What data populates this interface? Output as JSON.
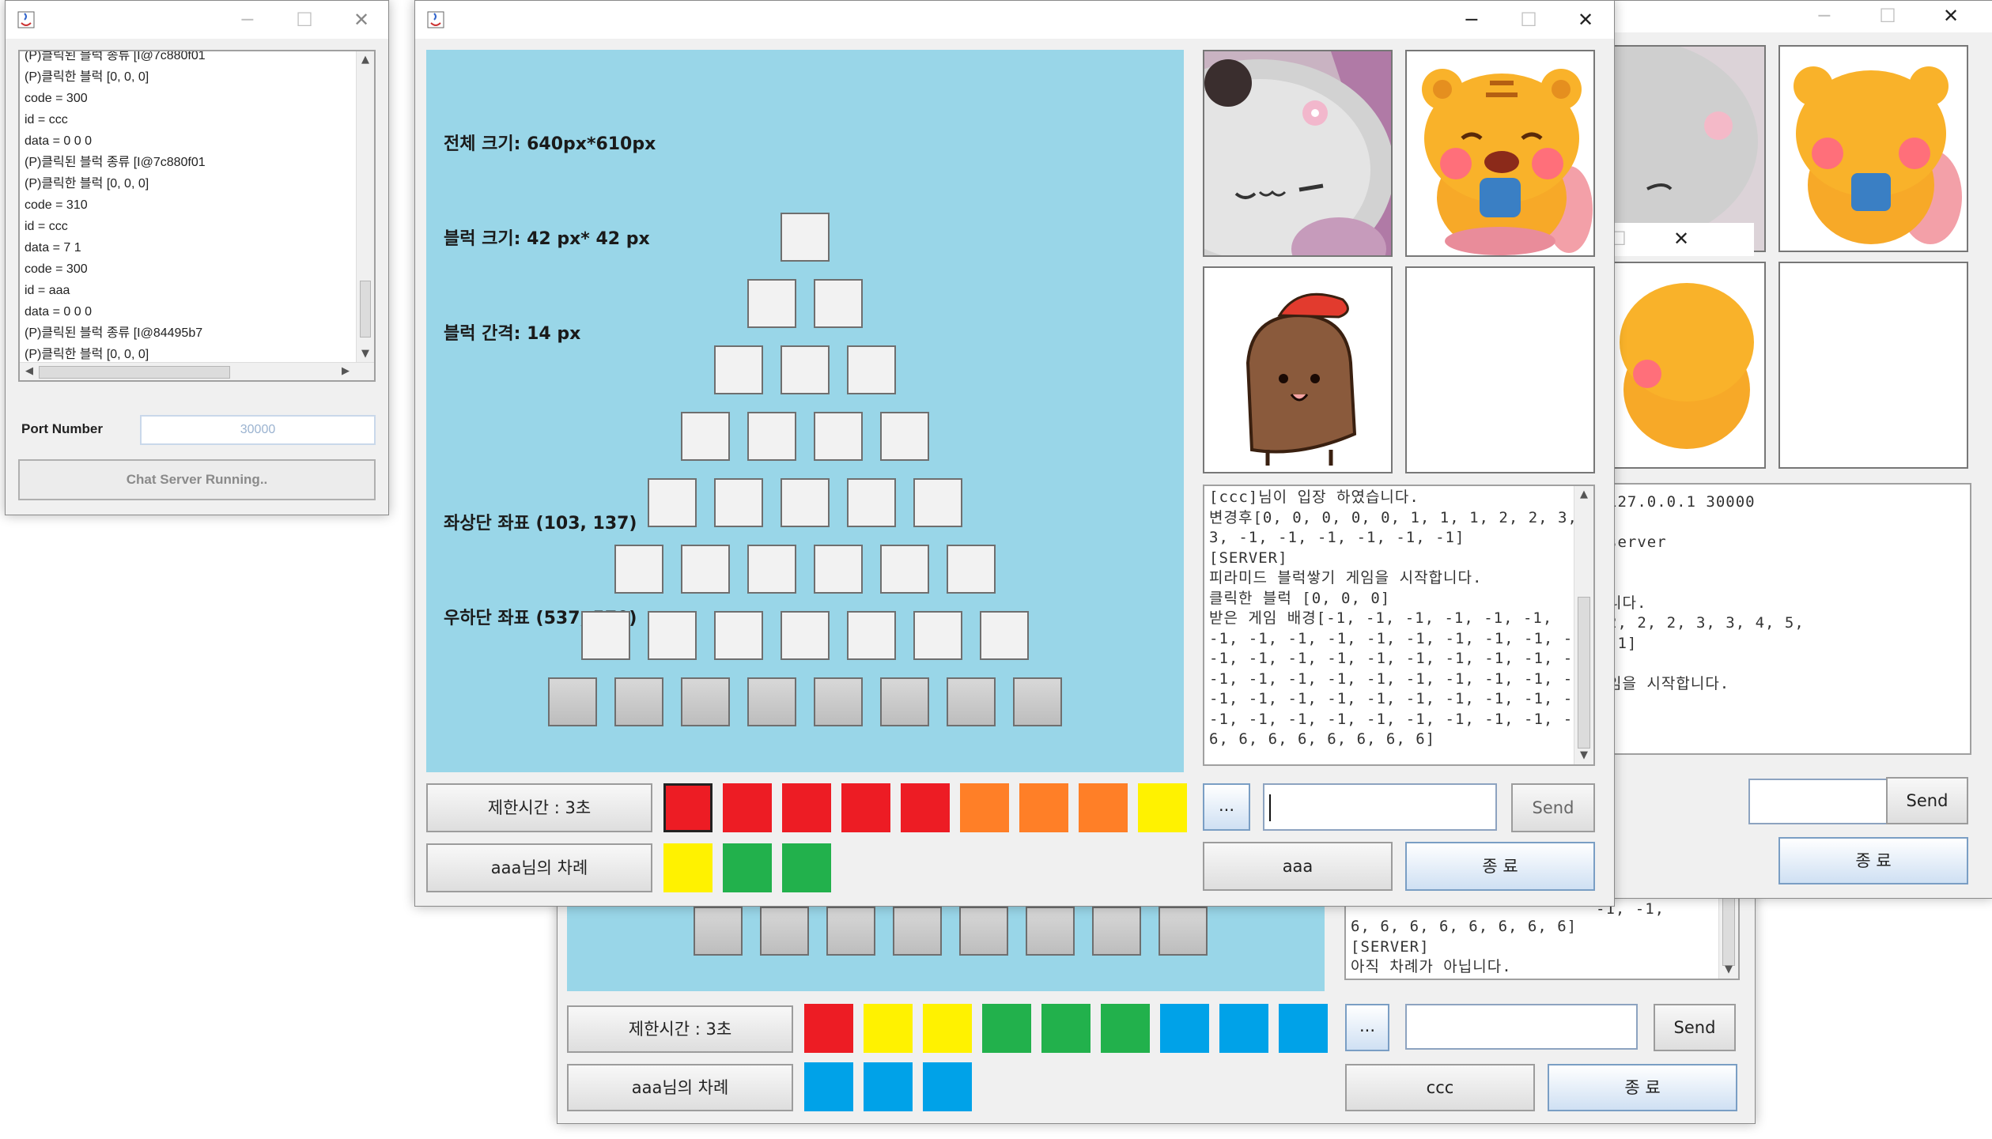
{
  "server": {
    "log": [
      "(P)클릭된 블럭 종류 [I@7c880f01",
      "(P)클릭한 블럭 [0, 0, 0]",
      "code = 300",
      "id = ccc",
      "data = 0 0 0",
      "(P)클릭된 블럭 종류 [I@7c880f01",
      "(P)클릭한 블럭 [0, 0, 0]",
      "code = 310",
      "id = ccc",
      "data = 7 1",
      "code = 300",
      "id = aaa",
      "data = 0 0 0",
      "(P)클릭된 블럭 종류 [I@84495b7",
      "(P)클릭한 블럭 [0, 0, 0]"
    ],
    "port_label": "Port Number",
    "port_value": "30000",
    "status_button": "Chat Server Running.."
  },
  "front": {
    "info": {
      "total_size": "전체 크기: 640px*610px",
      "block_size": "블럭 크기: 42 px* 42 px",
      "block_gap": "블럭 간격: 14 px",
      "top_left": "좌상단 좌표 (103, 137)",
      "bottom_right": "우하단 좌표 (537, 570)"
    },
    "timer_label": "제한시간 : 3초",
    "turn_label": "aaa님의 차례",
    "palette_row1": [
      "#ed1c24",
      "#ed1c24",
      "#ed1c24",
      "#ed1c24",
      "#ed1c24",
      "#ff7f27",
      "#ff7f27",
      "#ff7f27",
      "#fff200"
    ],
    "palette_row2": [
      "#fff200",
      "#22b14c",
      "#22b14c"
    ],
    "emoji_button": "...",
    "chat_input": "",
    "send_button": "Send",
    "user_name": "aaa",
    "exit_button": "종 료",
    "chat_log": [
      "[ccc]님이 입장 하였습니다.",
      "변경후[0, 0, 0, 0, 0, 1, 1, 1, 2, 2, 3,",
      "3, -1, -1, -1, -1, -1, -1]",
      "[SERVER]",
      "피라미드 블럭쌓기 게임을 시작합니다.",
      "클릭한 블럭 [0, 0, 0]",
      "받은 게임 배경[-1, -1, -1, -1, -1, -1,",
      "-1, -1, -1, -1, -1, -1, -1, -1, -1, -1,",
      "-1, -1, -1, -1, -1, -1, -1, -1, -1, -1,",
      "-1, -1, -1, -1, -1, -1, -1, -1, -1, -1,",
      "-1, -1, -1, -1, -1, -1, -1, -1, -1, -1,",
      "-1, -1, -1, -1, -1, -1, -1, -1, -1, -1,",
      "6, 6, 6, 6, 6, 6, 6, 6]"
    ]
  },
  "back": {
    "timer_label": "제한시간 : 3초",
    "turn_label": "aaa님의 차례",
    "palette_row1": [
      "#ed1c24",
      "#fff200",
      "#fff200",
      "#22b14c",
      "#22b14c",
      "#22b14c",
      "#00a2e8",
      "#00a2e8",
      "#00a2e8"
    ],
    "palette_row2": [
      "#00a2e8",
      "#00a2e8",
      "#00a2e8"
    ],
    "emoji_button": "...",
    "send_button": "Send",
    "user_name": "ccc",
    "exit_button": "종 료",
    "chat_visible": [
      "-1, -1,",
      "-1, -1,",
      "",
      "",
      "-1, -1,",
      "-1, -1,",
      "-1, -1,",
      "-1, -1,",
      "-1, -1,",
      "-1, -1,"
    ],
    "chat_tail": [
      "6, 6, 6, 6, 6, 6, 6, 6]",
      "[SERVER]",
      "아직 차례가 아닙니다."
    ]
  },
  "right": {
    "chat_visible": [
      "127.0.0.1 30000",
      "",
      "server",
      "",
      "",
      "니다.",
      "2, 2, 2, 3, 3, 4, 5,",
      "-1]",
      "",
      "임을 시작합니다."
    ],
    "send_button": "Send",
    "exit_button": "종 료"
  }
}
